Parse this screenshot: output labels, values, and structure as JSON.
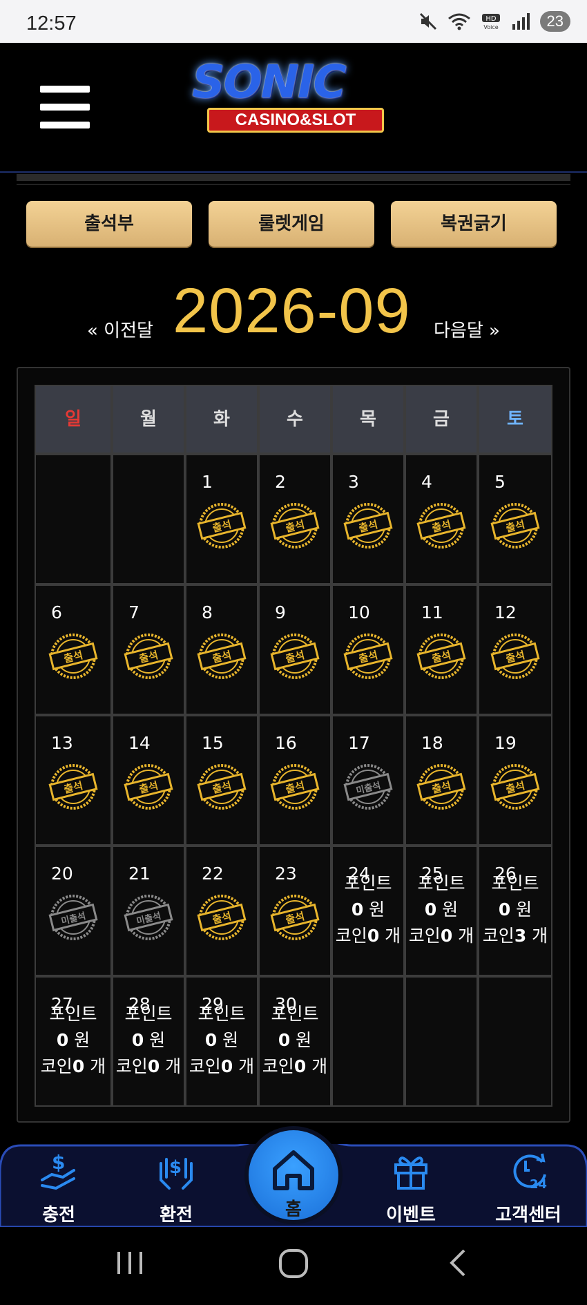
{
  "status_bar": {
    "time": "12:57",
    "battery": "23"
  },
  "header": {
    "logo_title": "SONIC",
    "logo_subtitle": "CASINO&SLOT"
  },
  "top_buttons": [
    "출석부",
    "룰렛게임",
    "복권긁기"
  ],
  "month_nav": {
    "prev": "« 이전달",
    "current": "2026-09",
    "next": "다음달 »"
  },
  "calendar": {
    "weekdays": [
      "일",
      "월",
      "화",
      "수",
      "목",
      "금",
      "토"
    ],
    "weekday_colors": [
      "#e53935",
      "#dddddd",
      "#dddddd",
      "#dddddd",
      "#dddddd",
      "#dddddd",
      "#6fb4ff"
    ],
    "stamp_present": "출석",
    "stamp_absent": "미출석",
    "point_label": "포인트",
    "won_unit": "원",
    "coin_label": "코인",
    "coin_unit": "개",
    "weeks": [
      [
        {
          "day": ""
        },
        {
          "day": ""
        },
        {
          "day": "1",
          "stamp": "present"
        },
        {
          "day": "2",
          "stamp": "present"
        },
        {
          "day": "3",
          "stamp": "present"
        },
        {
          "day": "4",
          "stamp": "present"
        },
        {
          "day": "5",
          "stamp": "present"
        }
      ],
      [
        {
          "day": "6",
          "stamp": "present"
        },
        {
          "day": "7",
          "stamp": "present"
        },
        {
          "day": "8",
          "stamp": "present"
        },
        {
          "day": "9",
          "stamp": "present"
        },
        {
          "day": "10",
          "stamp": "present"
        },
        {
          "day": "11",
          "stamp": "present"
        },
        {
          "day": "12",
          "stamp": "present"
        }
      ],
      [
        {
          "day": "13",
          "stamp": "present"
        },
        {
          "day": "14",
          "stamp": "present"
        },
        {
          "day": "15",
          "stamp": "present"
        },
        {
          "day": "16",
          "stamp": "present"
        },
        {
          "day": "17",
          "stamp": "absent"
        },
        {
          "day": "18",
          "stamp": "present"
        },
        {
          "day": "19",
          "stamp": "present"
        }
      ],
      [
        {
          "day": "20",
          "stamp": "absent"
        },
        {
          "day": "21",
          "stamp": "absent"
        },
        {
          "day": "22",
          "stamp": "present"
        },
        {
          "day": "23",
          "stamp": "present"
        },
        {
          "day": "24",
          "points": "0",
          "coins": "0"
        },
        {
          "day": "25",
          "points": "0",
          "coins": "0"
        },
        {
          "day": "26",
          "points": "0",
          "coins": "3"
        }
      ],
      [
        {
          "day": "27",
          "points": "0",
          "coins": "0"
        },
        {
          "day": "28",
          "points": "0",
          "coins": "0"
        },
        {
          "day": "29",
          "points": "0",
          "coins": "0"
        },
        {
          "day": "30",
          "points": "0",
          "coins": "0"
        },
        {
          "day": ""
        },
        {
          "day": ""
        },
        {
          "day": ""
        }
      ]
    ]
  },
  "bottom_nav": {
    "charge": "충전",
    "exchange": "환전",
    "home": "홈",
    "event": "이벤트",
    "support": "고객센터"
  },
  "colors": {
    "accent_gold": "#f2c44a",
    "nav_blue": "#2a8af0"
  }
}
